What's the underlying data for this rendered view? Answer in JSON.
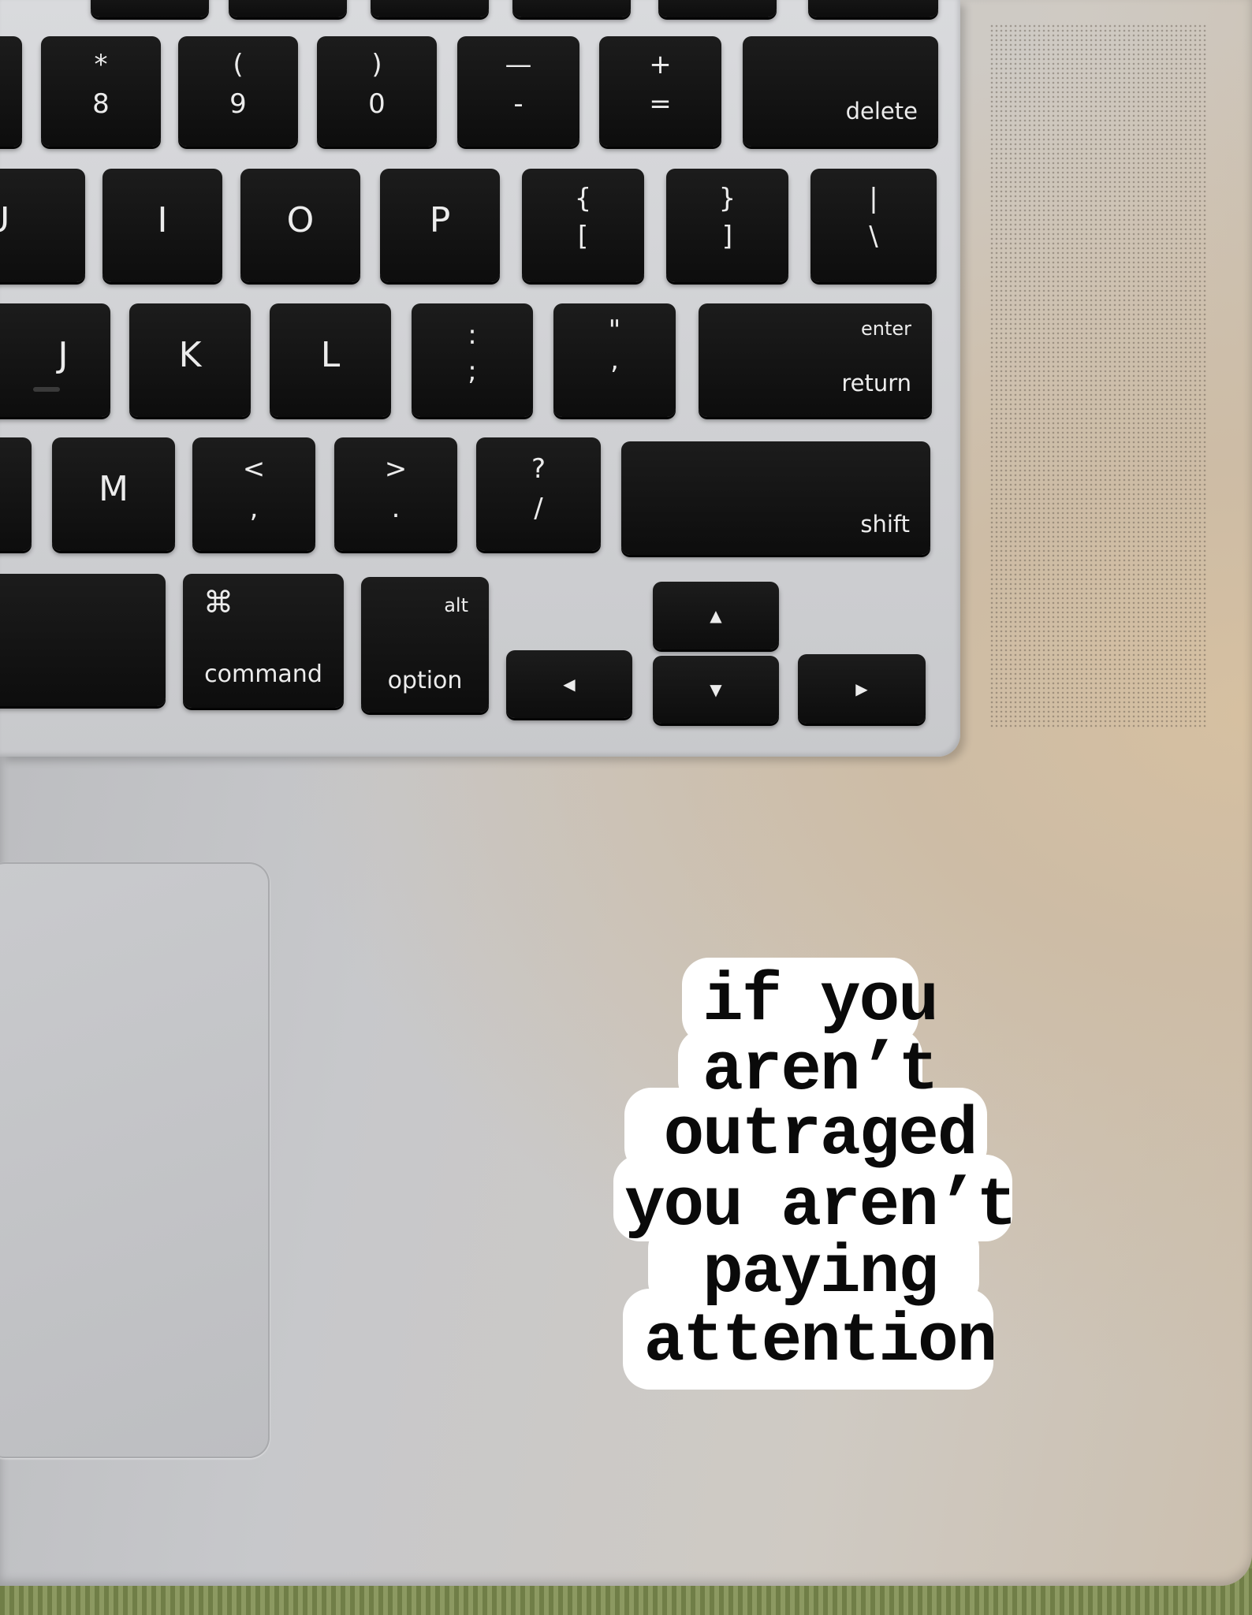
{
  "keys": {
    "asterisk": "*",
    "eight": "8",
    "lparen": "(",
    "nine": "9",
    "rparen": ")",
    "zero": "0",
    "underscore": "—",
    "minus": "-",
    "plus": "+",
    "equals": "=",
    "delete": "delete",
    "u": "U",
    "i": "I",
    "o": "O",
    "p": "P",
    "lbrace": "{",
    "lbracket": "[",
    "rbrace": "}",
    "rbracket": "]",
    "pipe": "|",
    "backslash": "\\",
    "j": "J",
    "k": "K",
    "l": "L",
    "colon": ":",
    "semicolon": ";",
    "dquote": "\"",
    "squote": ",",
    "enter": "enter",
    "return": "return",
    "m": "M",
    "lt": "<",
    "comma": ",",
    "gt": ">",
    "period": ".",
    "question": "?",
    "slash": "/",
    "shift": "shift",
    "cmd_symbol": "⌘",
    "command": "command",
    "alt": "alt",
    "option": "option",
    "arrow_left": "◀",
    "arrow_up": "▲",
    "arrow_down": "▼",
    "arrow_right": "▶"
  },
  "sticker": {
    "lines": [
      "if you",
      "aren’t",
      "outraged",
      "you aren’t",
      "paying",
      "attention"
    ]
  }
}
